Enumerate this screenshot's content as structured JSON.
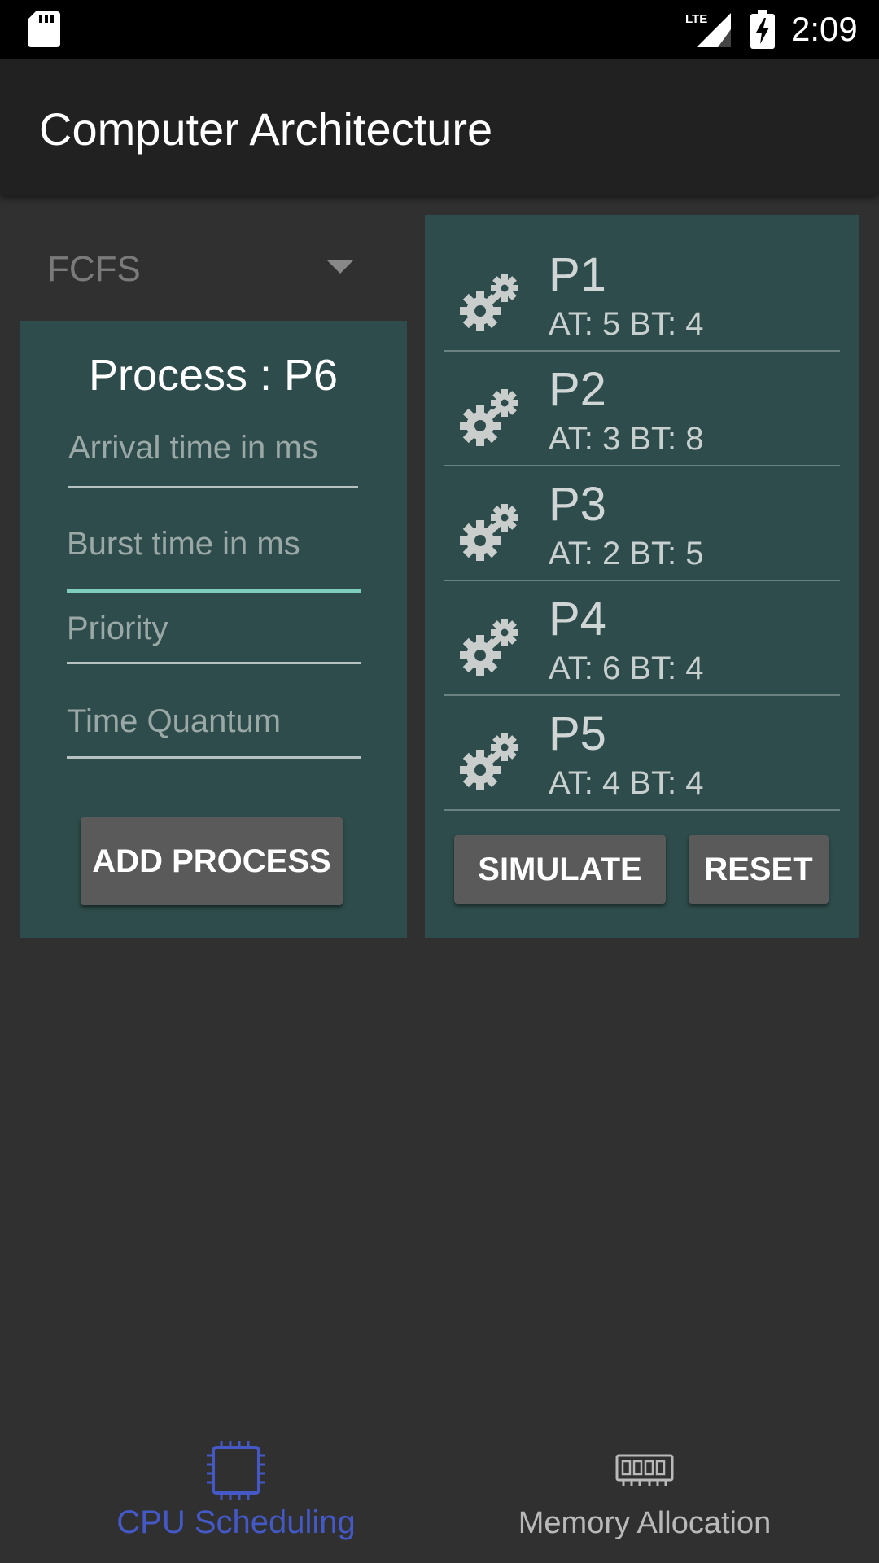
{
  "status_bar": {
    "network_label": "LTE",
    "time": "2:09",
    "icons": [
      "sd-card-icon",
      "lte-signal-icon",
      "battery-charging-icon"
    ]
  },
  "app_bar": {
    "title": "Computer Architecture"
  },
  "algorithm_spinner": {
    "selected": "FCFS"
  },
  "form": {
    "title": "Process : P6",
    "arrival_placeholder": "Arrival time in ms",
    "burst_placeholder": "Burst time in ms",
    "priority_placeholder": "Priority",
    "quantum_placeholder": "Time Quantum",
    "add_button": "ADD PROCESS"
  },
  "process_list": {
    "items": [
      {
        "name": "P1",
        "details": "AT: 5 BT: 4",
        "icon": "gears-icon"
      },
      {
        "name": "P2",
        "details": "AT: 3 BT: 8",
        "icon": "gears-icon"
      },
      {
        "name": "P3",
        "details": "AT: 2 BT: 5",
        "icon": "gears-icon"
      },
      {
        "name": "P4",
        "details": "AT: 6 BT: 4",
        "icon": "gears-icon"
      },
      {
        "name": "P5",
        "details": "AT: 4 BT: 4",
        "icon": "gears-icon"
      }
    ],
    "simulate_button": "SIMULATE",
    "reset_button": "RESET"
  },
  "bottom_nav": {
    "cpu_label": "CPU Scheduling",
    "memory_label": "Memory Allocation",
    "active": "CPU Scheduling"
  },
  "colors": {
    "card_background": "#2e4c4b",
    "accent_active": "#4458c6",
    "field_focus": "#7fcdbf"
  }
}
